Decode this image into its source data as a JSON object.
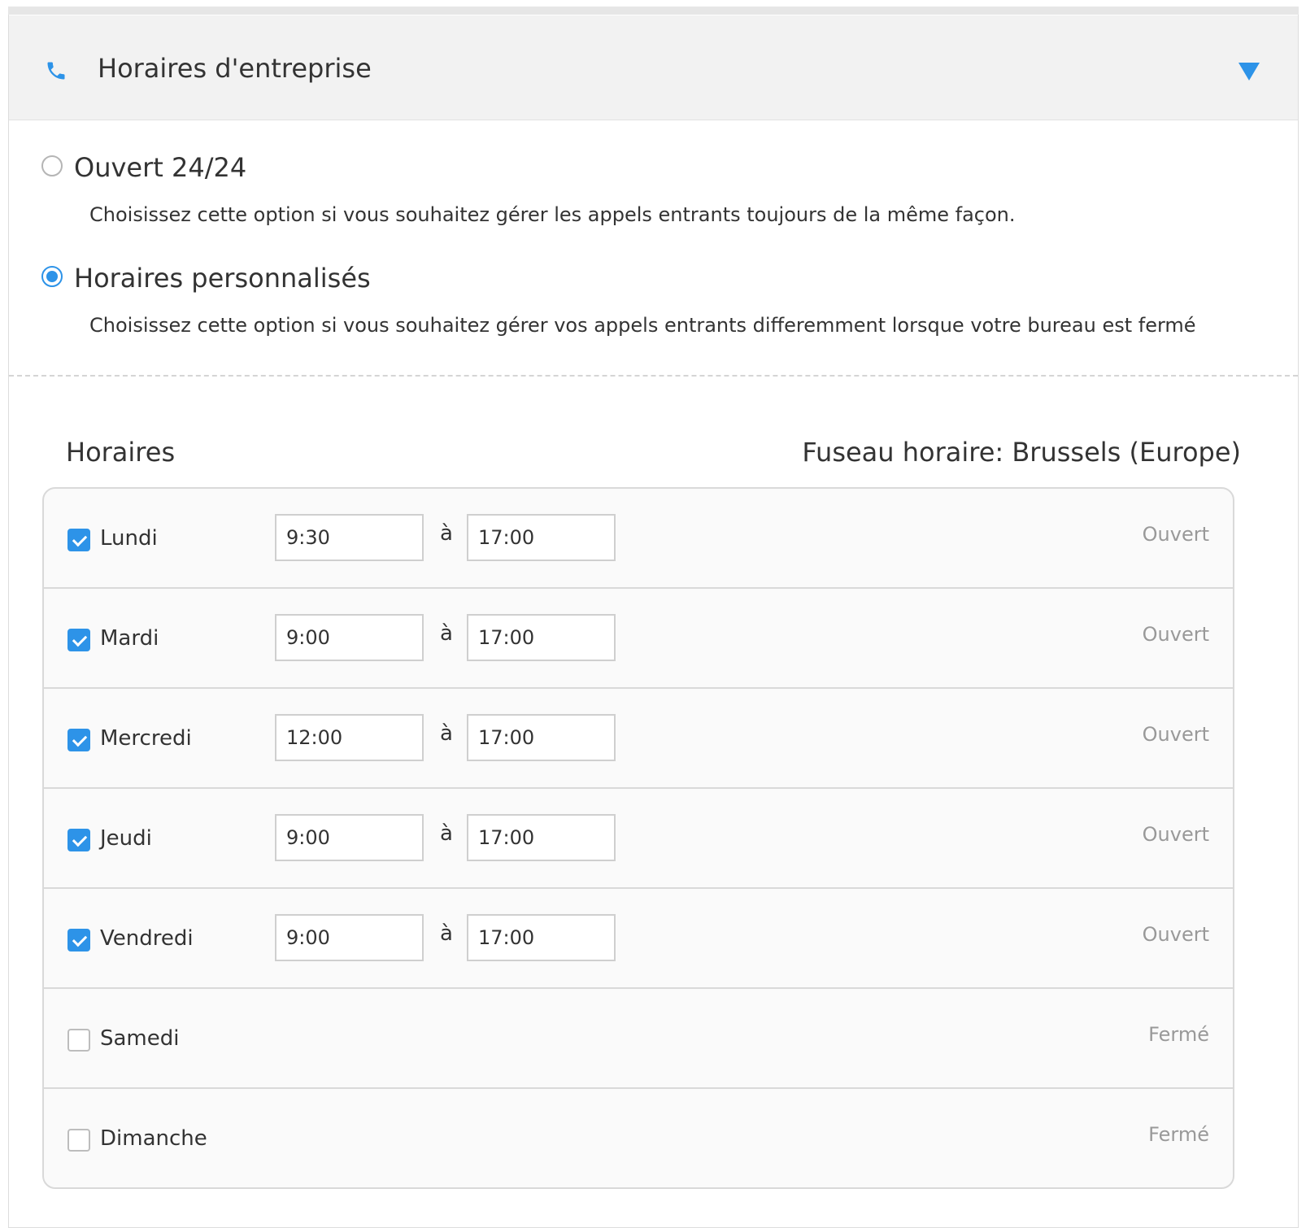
{
  "header": {
    "icon": "phone-icon",
    "title": "Horaires d'entreprise",
    "toggle_icon": "chevron-down-icon",
    "accent_color": "#2d93e8"
  },
  "options": [
    {
      "title": "Ouvert 24/24",
      "description": "Choisissez cette option si vous souhaitez gérer les appels entrants toujours de la même façon.",
      "selected": false
    },
    {
      "title": "Horaires personnalisés",
      "description": "Choisissez cette option si vous souhaitez gérer vos appels entrants differemment lorsque votre bureau est fermé",
      "selected": true
    }
  ],
  "schedule": {
    "title": "Horaires",
    "timezone": "Fuseau horaire:  Brussels (Europe)",
    "separator": "à",
    "days": [
      {
        "name": "Lundi",
        "checked": true,
        "from": "9:30",
        "to": "17:00",
        "status": "Ouvert"
      },
      {
        "name": "Mardi",
        "checked": true,
        "from": "9:00",
        "to": "17:00",
        "status": "Ouvert"
      },
      {
        "name": "Mercredi",
        "checked": true,
        "from": "12:00",
        "to": "17:00",
        "status": "Ouvert"
      },
      {
        "name": "Jeudi",
        "checked": true,
        "from": "9:00",
        "to": "17:00",
        "status": "Ouvert"
      },
      {
        "name": "Vendredi",
        "checked": true,
        "from": "9:00",
        "to": "17:00",
        "status": "Ouvert"
      },
      {
        "name": "Samedi",
        "checked": false,
        "status": "Fermé"
      },
      {
        "name": "Dimanche",
        "checked": false,
        "status": "Fermé"
      }
    ]
  }
}
